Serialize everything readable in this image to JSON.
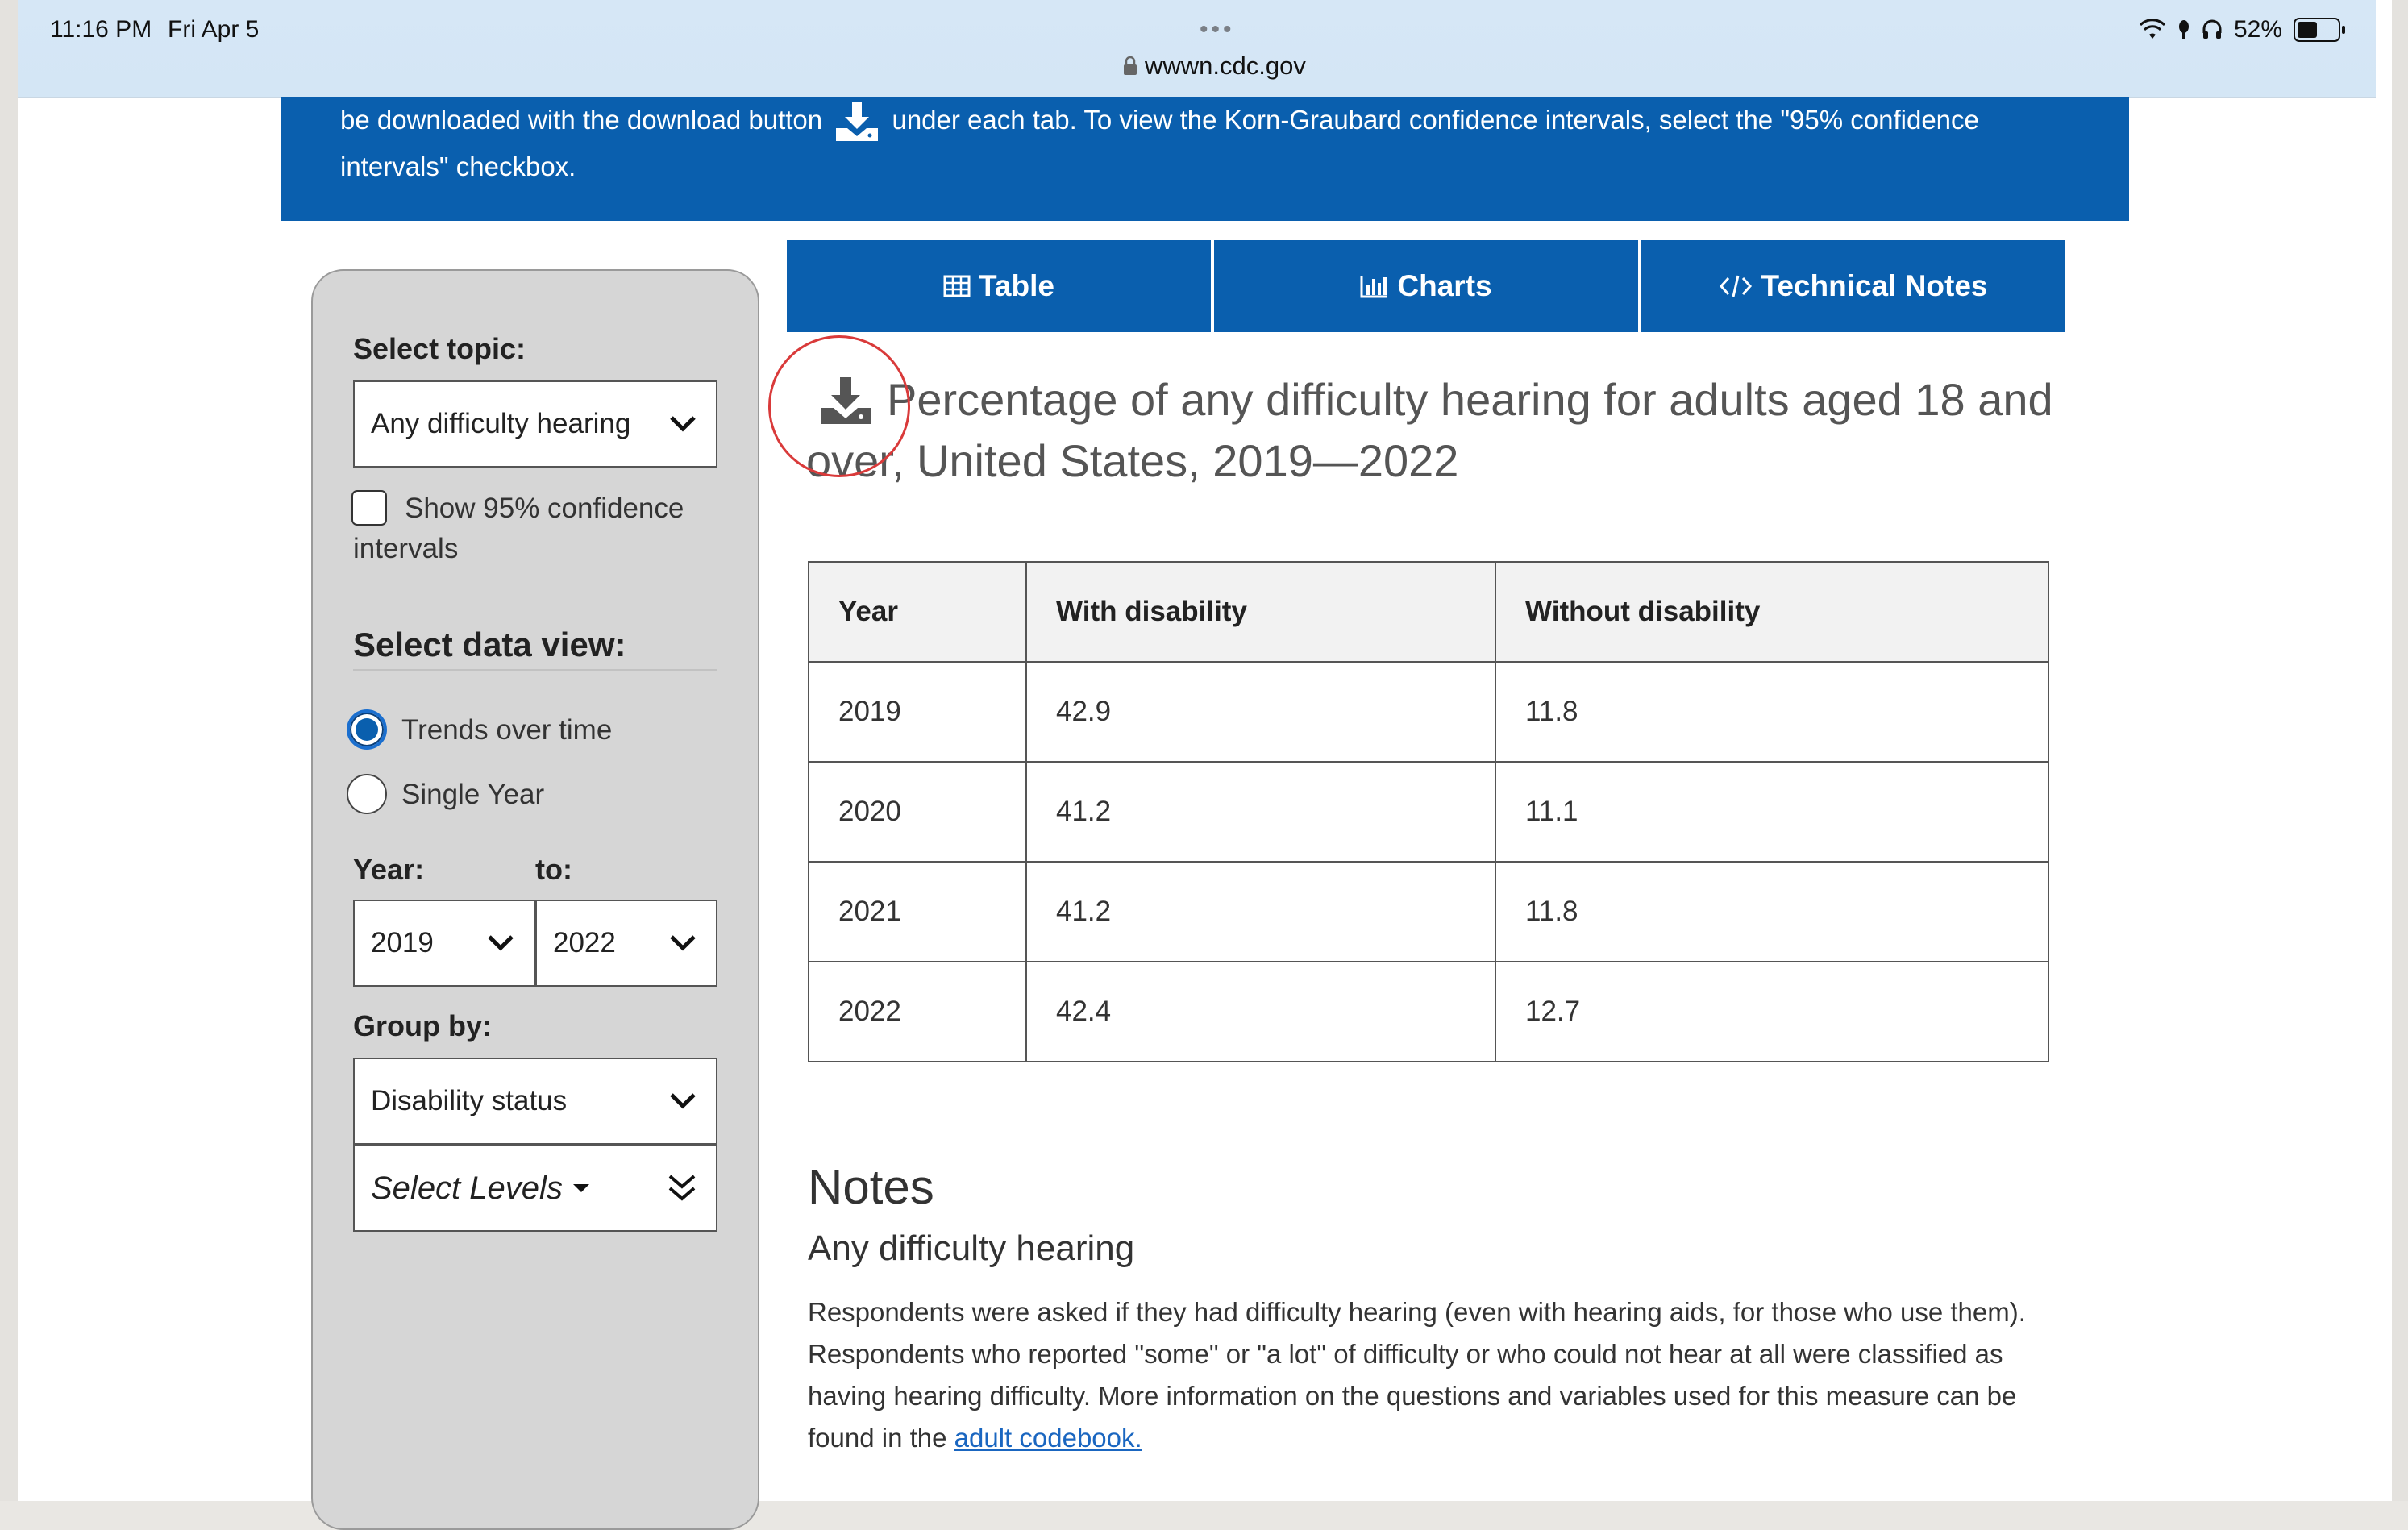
{
  "status_bar": {
    "time": "11:16 PM",
    "date": "Fri Apr 5",
    "dots": "•••",
    "url": "wwwn.cdc.gov",
    "battery_label": "52%",
    "battery_level": 0.52
  },
  "banner": {
    "text_before": "be downloaded with the download button",
    "text_after": "under each tab. To view the Korn-Graubard confidence intervals, select the \"95% confidence intervals\" checkbox."
  },
  "sidebar": {
    "topic_label": "Select topic:",
    "topic_value": "Any difficulty hearing",
    "ci_label": "Show 95% confidence intervals",
    "view_label": "Select data view:",
    "view_options": [
      "Trends over time",
      "Single Year"
    ],
    "view_selected": "Trends over time",
    "year_label": "Year:",
    "to_label": "to:",
    "year_from": "2019",
    "year_to": "2022",
    "group_label": "Group by:",
    "group_value": "Disability status",
    "levels_label": "Select Levels"
  },
  "tabs": [
    {
      "label": "Table",
      "icon": "table-icon"
    },
    {
      "label": "Charts",
      "icon": "bar-chart-icon"
    },
    {
      "label": "Technical Notes",
      "icon": "code-icon"
    }
  ],
  "title": "Percentage of any difficulty hearing for adults aged 18 and over, United States, 2019—2022",
  "table": {
    "headers": [
      "Year",
      "With disability",
      "Without disability"
    ],
    "rows": [
      [
        "2019",
        "42.9",
        "11.8"
      ],
      [
        "2020",
        "41.2",
        "11.1"
      ],
      [
        "2021",
        "41.2",
        "11.8"
      ],
      [
        "2022",
        "42.4",
        "12.7"
      ]
    ]
  },
  "notes": {
    "heading": "Notes",
    "subheading": "Any difficulty hearing",
    "body": "Respondents were asked if they had difficulty hearing (even with hearing aids, for those who use them). Respondents who reported \"some\" or \"a lot\" of difficulty or who could not hear at all were classified as having hearing difficulty. More information on the questions and variables used for this measure can be found in the",
    "link_text": "adult codebook."
  },
  "colors": {
    "brand_blue": "#0a5fae",
    "highlight_ring": "#d93a3a",
    "link": "#1a66c0"
  }
}
